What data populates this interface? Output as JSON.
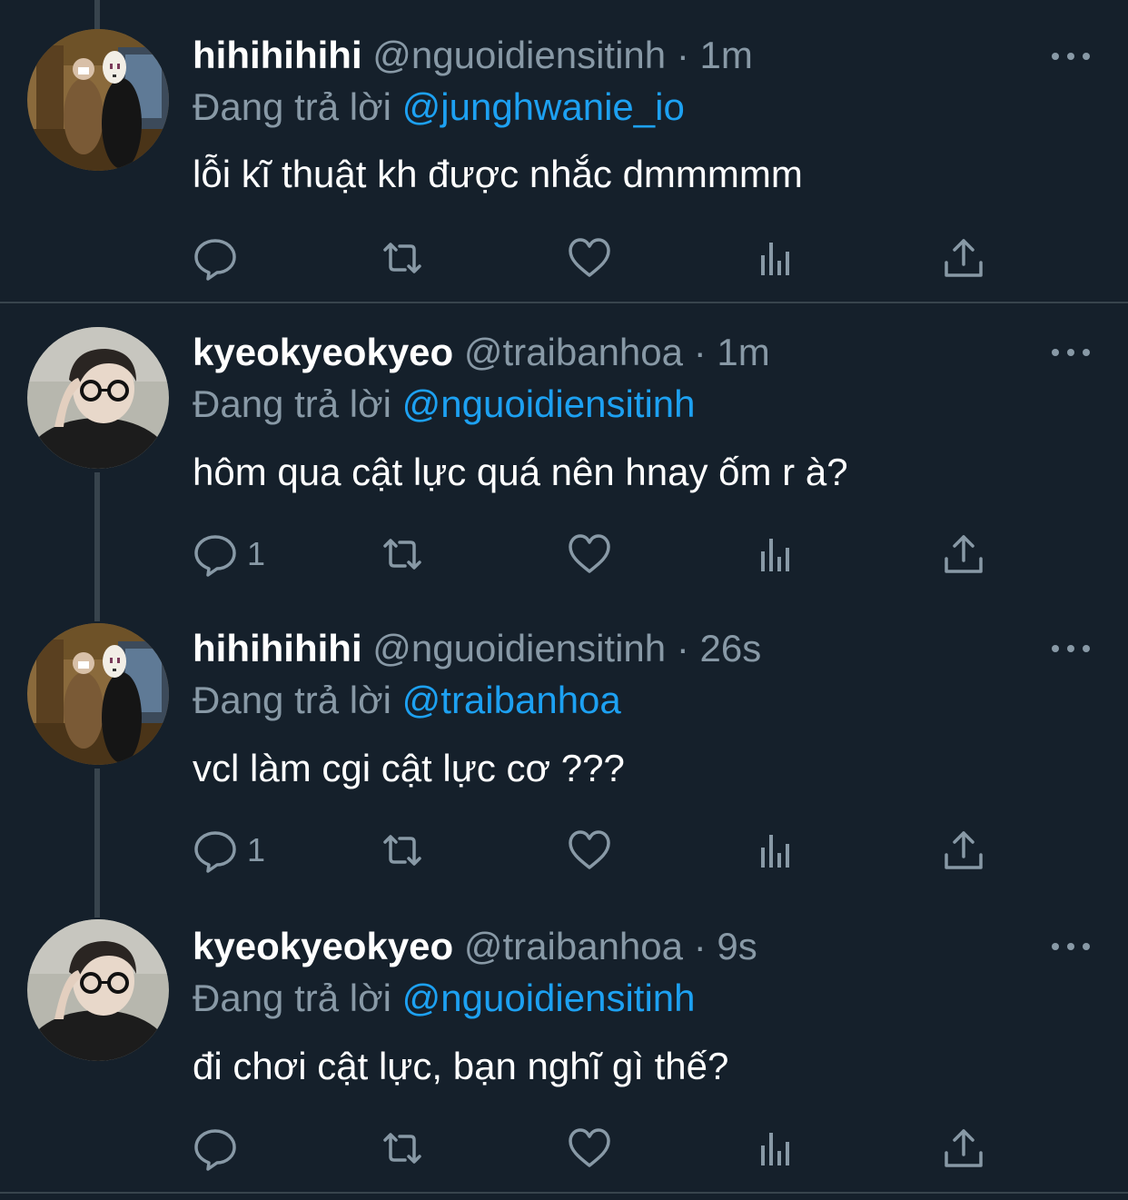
{
  "tweets": [
    {
      "name": "hihihihihi",
      "handle": "@nguoidiensitinh",
      "dot": "·",
      "time": "1m",
      "reply_prefix": "Đang trả lời",
      "reply_to": "@junghwanie_io",
      "text": "lỗi kĩ thuật kh được nhắc dmmmmm",
      "reply_count": "",
      "avatar": "no-face-avatar"
    },
    {
      "name": "kyeokyeokyeo",
      "handle": "@traibanhoa",
      "dot": "·",
      "time": "1m",
      "reply_prefix": "Đang trả lời",
      "reply_to": "@nguoidiensitinh",
      "text": "hôm qua cật lực quá nên hnay ốm r à?",
      "reply_count": "1",
      "avatar": "glasses-person-avatar"
    },
    {
      "name": "hihihihihi",
      "handle": "@nguoidiensitinh",
      "dot": "·",
      "time": "26s",
      "reply_prefix": "Đang trả lời",
      "reply_to": "@traibanhoa",
      "text": "vcl làm cgi cật lực cơ ???",
      "reply_count": "1",
      "avatar": "no-face-avatar"
    },
    {
      "name": "kyeokyeokyeo",
      "handle": "@traibanhoa",
      "dot": "·",
      "time": "9s",
      "reply_prefix": "Đang trả lời",
      "reply_to": "@nguoidiensitinh",
      "text": "đi chơi cật lực, bạn nghĩ gì thế?",
      "reply_count": "",
      "avatar": "glasses-person-avatar"
    }
  ],
  "colors": {
    "background": "#15202b",
    "text": "#ffffff",
    "secondary": "#8899a6",
    "link": "#1da1f2",
    "divider": "#38444d"
  },
  "icons": [
    "reply-icon",
    "retweet-icon",
    "like-icon",
    "analytics-icon",
    "share-icon",
    "more-icon"
  ]
}
